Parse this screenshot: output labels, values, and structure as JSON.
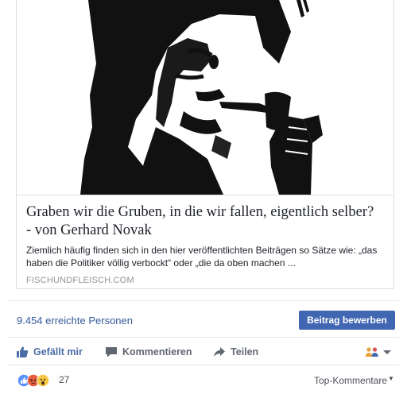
{
  "link_preview": {
    "title": "Graben wir die Gruben, in die wir fallen, eigentlich selber? - von Gerhard Novak",
    "description": "Ziemlich häufig finden sich in den hier veröffentlichten Beiträgen so Sätze wie: „das haben die Politiker völlig verbockt“ oder „die da oben machen ...",
    "domain": "FISCHUNDFLEISCH.COM",
    "image_icon": "man-smoking-pipe-illustration"
  },
  "insights": {
    "reach_text": "9.454 erreichte Personen",
    "boost_label": "Beitrag bewerben"
  },
  "actions": {
    "like_label": "Gefällt mir",
    "comment_label": "Kommentieren",
    "share_label": "Teilen",
    "like_icon": "thumbs-up-icon",
    "comment_icon": "speech-bubble-icon",
    "share_icon": "share-arrow-icon",
    "audience_icon": "friends-icon"
  },
  "reactions": {
    "count": "27",
    "types": [
      "like",
      "angry",
      "wow"
    ],
    "sort_label": "Top-Kommentare"
  },
  "colors": {
    "link_blue": "#365899",
    "button_blue": "#4267b2",
    "like_blue": "#4b6ea8",
    "text_dark": "#1d2129",
    "text_muted": "#90949c"
  }
}
